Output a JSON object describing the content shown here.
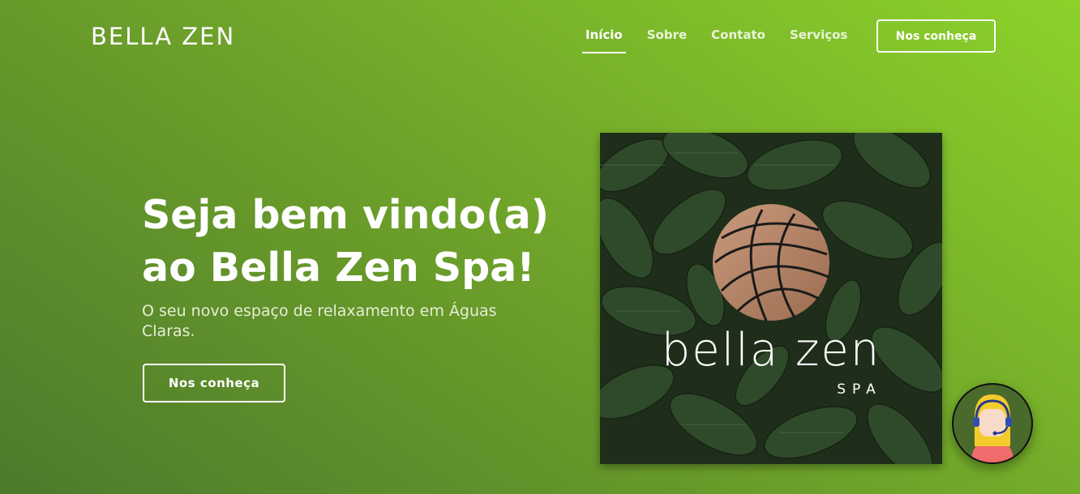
{
  "header": {
    "brand": "BELLA ZEN",
    "nav": [
      {
        "label": "Início",
        "active": true
      },
      {
        "label": "Sobre",
        "active": false
      },
      {
        "label": "Contato",
        "active": false
      },
      {
        "label": "Serviços",
        "active": false
      }
    ],
    "cta_label": "Nos conheça"
  },
  "hero": {
    "title_line1": "Seja bem vindo(a)",
    "title_line2": "ao Bella Zen Spa!",
    "subtitle": "O seu novo espaço de relaxamento em Águas Claras.",
    "cta_label": "Nos conheça",
    "image": {
      "logo_text": "bella zen",
      "logo_subtext": "SPA"
    }
  },
  "chat": {
    "icon": "support-agent-icon"
  },
  "colors": {
    "gradient_start": "#4d7a2c",
    "gradient_end": "#8cd22a",
    "logo_copper": "#b8876a"
  }
}
